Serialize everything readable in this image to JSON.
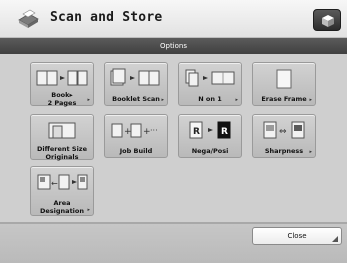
{
  "header": {
    "title": "Scan and Store"
  },
  "options_bar": {
    "label": "Options"
  },
  "options": [
    {
      "label": "Book▸\n2 Pages",
      "icon": "book-to-two-pages-icon"
    },
    {
      "label": "Booklet Scan",
      "icon": "booklet-scan-icon"
    },
    {
      "label": "N on 1",
      "icon": "n-on-1-icon"
    },
    {
      "label": "Erase Frame",
      "icon": "erase-frame-icon"
    },
    {
      "label": "Different Size\nOriginals",
      "icon": "different-size-originals-icon"
    },
    {
      "label": "Job Build",
      "icon": "job-build-icon"
    },
    {
      "label": "Nega/Posi",
      "icon": "nega-posi-icon"
    },
    {
      "label": "Sharpness",
      "icon": "sharpness-icon"
    },
    {
      "label": "Area\nDesignation",
      "icon": "area-designation-icon"
    }
  ],
  "footer": {
    "close_label": "Close"
  }
}
